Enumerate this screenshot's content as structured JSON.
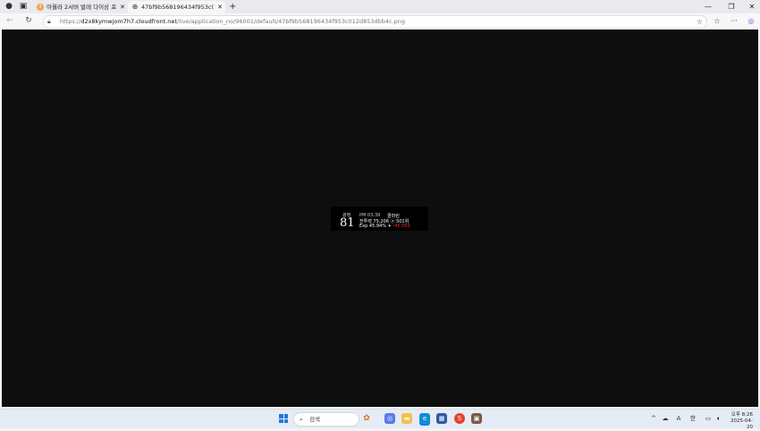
{
  "browser": {
    "tabs": [
      {
        "title": "아월라 2서버 발레 다이상 포볼가",
        "favicon": "3",
        "close": "✕"
      },
      {
        "title": "47bf9b568196434f953c012d853dbb4c.png",
        "favicon": "⊕",
        "close": "✕"
      }
    ],
    "new_tab": "+",
    "window_controls": {
      "minimize": "—",
      "maximize": "❐",
      "close": "✕"
    },
    "nav": {
      "back": "←",
      "refresh": "↻"
    },
    "address": {
      "scheme": "https://",
      "host": "d2x8kymwjom7h7.cloudfront.net",
      "path": "/live/application_no/96001/default/47bf9b568196434f953c012d853dbb4c.png"
    },
    "toolbar": {
      "favorite": "☆",
      "collections": "☆",
      "more": "···",
      "copilot": "◎"
    }
  },
  "overlay": {
    "label": "광정",
    "level": "81",
    "time": "PM 03:39",
    "user": "콜마린",
    "line2": "전투력 75,206 ⓐ 501위",
    "exp": "Exp 45.94%",
    "arrow": "✈",
    "delta": "-45,550"
  },
  "taskbar": {
    "search_label": "검색",
    "tray": {
      "chevron": "^",
      "font": "A",
      "ime": "한"
    },
    "time": "오후 8:26",
    "date": "2025-04-20"
  },
  "colors": {
    "viewport_bg": "#0e0e0e",
    "delta_red": "#ff2b2b",
    "taskbar_bg": "#e6ecf5"
  }
}
